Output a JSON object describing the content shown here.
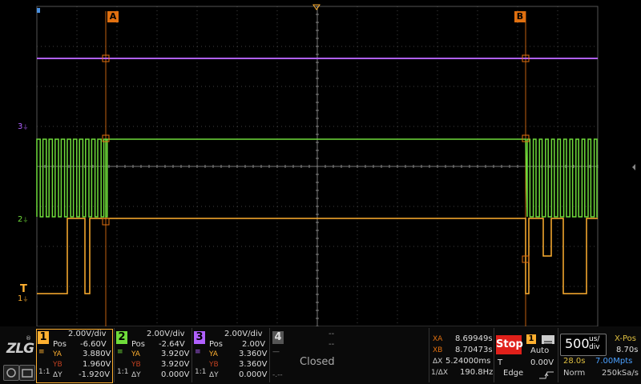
{
  "scope": {
    "cursor_a_label": "A",
    "cursor_b_label": "B",
    "trigger_marker": "T",
    "channel_markers": [
      "3",
      "2",
      "1"
    ]
  },
  "colors": {
    "ch1": "#ffb030",
    "ch2": "#6fdc3a",
    "ch3": "#b060ff",
    "cursor": "#e07010",
    "stop": "#e0201a"
  },
  "logo": "ZLG",
  "ch1": {
    "num": "1",
    "vdiv": "2.00V/div",
    "pos_label": "Pos",
    "pos": "-6.60V",
    "ya_label": "YA",
    "ya": "3.880V",
    "yb_label": "YB",
    "yb": "1.960V",
    "dy_label": "ΔY",
    "dy": "-1.920V",
    "coupling": "1:1"
  },
  "ch2": {
    "num": "2",
    "vdiv": "2.00V/div",
    "pos_label": "Pos",
    "pos": "-2.64V",
    "ya_label": "YA",
    "ya": "3.920V",
    "yb_label": "YB",
    "yb": "3.920V",
    "dy_label": "ΔY",
    "dy": "0.000V",
    "coupling": "1:1"
  },
  "ch3": {
    "num": "3",
    "vdiv": "2.00V/div",
    "pos_label": "Pos",
    "pos": "2.00V",
    "ya_label": "YA",
    "ya": "3.360V",
    "yb_label": "YB",
    "yb": "3.360V",
    "dy_label": "ΔY",
    "dy": "0.000V",
    "coupling": "1:1"
  },
  "ch4": {
    "num": "4",
    "dash1": "--",
    "dash2": "--",
    "status": "Closed",
    "dash3": "-.--"
  },
  "cursors": {
    "xa_label": "XA",
    "xa": "8.69949s",
    "xb_label": "XB",
    "xb": "8.70473s",
    "dx_label": "ΔX",
    "dx": "5.24000ms",
    "inv_label": "1/ΔX",
    "inv": "190.8Hz"
  },
  "trigger": {
    "status": "Stop",
    "channel": "1",
    "mode": "Auto",
    "t_label": "T",
    "level": "0.00V",
    "type": "Edge"
  },
  "timebase": {
    "value": "500",
    "unit_top": "us/",
    "unit_bot": "div",
    "time": "28.0s",
    "mem": "7.00Mpts",
    "mode": "Norm"
  },
  "xpos": {
    "label": "X-Pos",
    "value": "8.70s",
    "rate": "250kSa/s"
  }
}
